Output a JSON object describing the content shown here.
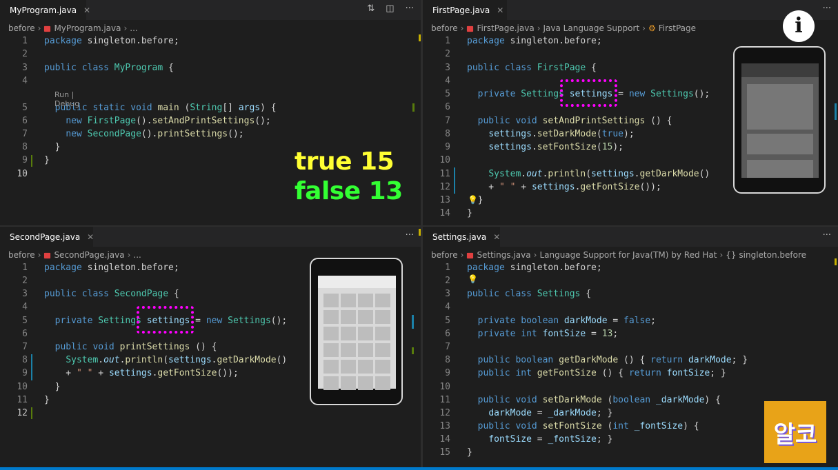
{
  "panes": {
    "top_left": {
      "tab": "MyProgram.java",
      "crumbs": [
        "before",
        "MyProgram.java",
        "..."
      ],
      "codelens": "Run | Debug",
      "line_numbers": [
        "1",
        "2",
        "3",
        "4",
        "5",
        "6",
        "7",
        "8",
        "9",
        "10"
      ],
      "lines": [
        [
          "kw:package",
          "t: singleton.before;"
        ],
        [],
        [
          "kw:public",
          "t: ",
          "kw:class",
          "t: ",
          "cls:MyProgram",
          "t: {"
        ],
        [],
        [
          "t:  ",
          "kw:public",
          "t: ",
          "kw:static",
          "t: ",
          "kw:void",
          "t: ",
          "fn:main",
          "t: (",
          "cls:String",
          "t:[] ",
          "var:args",
          "t:) {"
        ],
        [
          "t:    ",
          "kw:new",
          "t: ",
          "cls:FirstPage",
          "t:().",
          "fn:setAndPrintSettings",
          "t:();"
        ],
        [
          "t:    ",
          "kw:new",
          "t: ",
          "cls:SecondPage",
          "t:().",
          "fn:printSettings",
          "t:();"
        ],
        [
          "t:  }"
        ],
        [
          "t:}"
        ],
        []
      ]
    },
    "top_right": {
      "tab": "FirstPage.java",
      "crumbs": [
        "before",
        "FirstPage.java",
        "Java Language Support",
        "FirstPage"
      ],
      "line_numbers": [
        "1",
        "2",
        "3",
        "4",
        "5",
        "6",
        "7",
        "8",
        "9",
        "10",
        "11",
        "12",
        "13",
        "14"
      ],
      "lines": [
        [
          "kw:package",
          "t: singleton.before;"
        ],
        [],
        [
          "kw:public",
          "t: ",
          "kw:class",
          "t: ",
          "cls:FirstPage",
          "t: {"
        ],
        [],
        [
          "t:  ",
          "kw:private",
          "t: ",
          "cls:Settings",
          "t: ",
          "var:settings",
          "t: = ",
          "kw:new",
          "t: ",
          "cls:Settings",
          "t:();"
        ],
        [],
        [
          "t:  ",
          "kw:public",
          "t: ",
          "kw:void",
          "t: ",
          "fn:setAndPrintSettings",
          "t: () {"
        ],
        [
          "t:    ",
          "var:settings",
          "t:.",
          "fn:setDarkMode",
          "t:(",
          "kw:true",
          "t:);"
        ],
        [
          "t:    ",
          "var:settings",
          "t:.",
          "fn:setFontSize",
          "t:(",
          "num:15",
          "t:);"
        ],
        [],
        [
          "t:    ",
          "cls:System",
          "t:.",
          "it:out",
          "t:.",
          "fn:println",
          "t:(",
          "var:settings",
          "t:.",
          "fn:getDarkMode",
          "t:()"
        ],
        [
          "t:    + ",
          "str:\" \"",
          "t: + ",
          "var:settings",
          "t:.",
          "fn:getFontSize",
          "t:());"
        ],
        [
          "t:  }"
        ],
        [
          "t:}"
        ]
      ]
    },
    "bottom_left": {
      "tab": "SecondPage.java",
      "crumbs": [
        "before",
        "SecondPage.java",
        "..."
      ],
      "line_numbers": [
        "1",
        "2",
        "3",
        "4",
        "5",
        "6",
        "7",
        "8",
        "9",
        "10",
        "11",
        "12"
      ],
      "lines": [
        [
          "kw:package",
          "t: singleton.before;"
        ],
        [],
        [
          "kw:public",
          "t: ",
          "kw:class",
          "t: ",
          "cls:SecondPage",
          "t: {"
        ],
        [],
        [
          "t:  ",
          "kw:private",
          "t: ",
          "cls:Settings",
          "t: ",
          "var:settings",
          "t: = ",
          "kw:new",
          "t: ",
          "cls:Settings",
          "t:();"
        ],
        [],
        [
          "t:  ",
          "kw:public",
          "t: ",
          "kw:void",
          "t: ",
          "fn:printSettings",
          "t: () {"
        ],
        [
          "t:    ",
          "cls:System",
          "t:.",
          "it:out",
          "t:.",
          "fn:println",
          "t:(",
          "var:settings",
          "t:.",
          "fn:getDarkMode",
          "t:()"
        ],
        [
          "t:    + ",
          "str:\" \"",
          "t: + ",
          "var:settings",
          "t:.",
          "fn:getFontSize",
          "t:());"
        ],
        [
          "t:  }"
        ],
        [
          "t:}"
        ],
        []
      ]
    },
    "bottom_right": {
      "tab": "Settings.java",
      "crumbs": [
        "before",
        "Settings.java",
        "Language Support for Java(TM) by Red Hat",
        "{} singleton.before"
      ],
      "line_numbers": [
        "1",
        "2",
        "3",
        "4",
        "5",
        "6",
        "7",
        "8",
        "9",
        "10",
        "11",
        "12",
        "13",
        "14",
        "15"
      ],
      "lines": [
        [
          "kw:package",
          "t: singleton.before;"
        ],
        [],
        [
          "kw:public",
          "t: ",
          "kw:class",
          "t: ",
          "cls:Settings",
          "t: {"
        ],
        [],
        [
          "t:  ",
          "kw:private",
          "t: ",
          "kw:boolean",
          "t: ",
          "var:darkMode",
          "t: = ",
          "kw:false",
          "t:;"
        ],
        [
          "t:  ",
          "kw:private",
          "t: ",
          "kw:int",
          "t: ",
          "var:fontSize",
          "t: = ",
          "num:13",
          "t:;"
        ],
        [],
        [
          "t:  ",
          "kw:public",
          "t: ",
          "kw:boolean",
          "t: ",
          "fn:getDarkMode",
          "t: () { ",
          "kw:return",
          "t: ",
          "var:darkMode",
          "t:; }"
        ],
        [
          "t:  ",
          "kw:public",
          "t: ",
          "kw:int",
          "t: ",
          "fn:getFontSize",
          "t: () { ",
          "kw:return",
          "t: ",
          "var:fontSize",
          "t:; }"
        ],
        [],
        [
          "t:  ",
          "kw:public",
          "t: ",
          "kw:void",
          "t: ",
          "fn:setDarkMode",
          "t: (",
          "kw:boolean",
          "t: ",
          "var:_darkMode",
          "t:) {"
        ],
        [
          "t:    ",
          "var:darkMode",
          "t: = ",
          "var:_darkMode",
          "t:; }"
        ],
        [
          "t:  ",
          "kw:public",
          "t: ",
          "kw:void",
          "t: ",
          "fn:setFontSize",
          "t: (",
          "kw:int",
          "t: ",
          "var:_fontSize",
          "t:) {"
        ],
        [
          "t:    ",
          "var:fontSize",
          "t: = ",
          "var:_fontSize",
          "t:; }"
        ],
        [
          "t:}"
        ]
      ]
    }
  },
  "overlay": {
    "output_line1": "true 15",
    "output_line2": "false 13",
    "line1_color": "#ffff33",
    "line2_color": "#33ff33"
  },
  "info_button": "i",
  "logo_text": "알코",
  "icons": {
    "java_file": "java-file-icon",
    "compare": "compare-changes-icon",
    "split": "split-editor-icon",
    "more": "more-actions-icon",
    "info": "info-icon",
    "bulb": "lightbulb-icon"
  },
  "colors": {
    "highlight": "#ff00ff",
    "editor_bg": "#1e1e1e"
  }
}
